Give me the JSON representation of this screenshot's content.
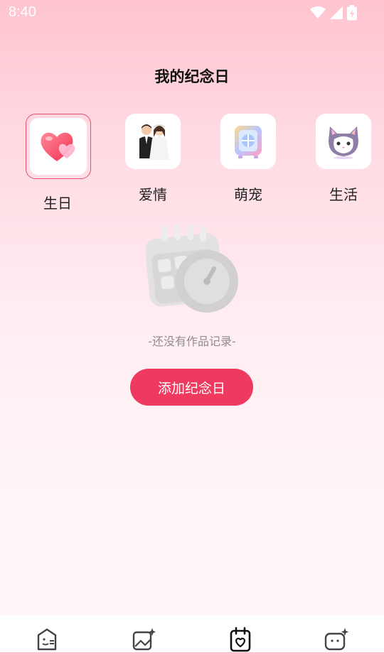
{
  "status": {
    "time": "8:40"
  },
  "page": {
    "title": "我的纪念日"
  },
  "categories": [
    {
      "label": "生日",
      "icon": "heart-icon",
      "selected": true
    },
    {
      "label": "爱情",
      "icon": "wedding-couple-icon",
      "selected": false
    },
    {
      "label": "萌宠",
      "icon": "pet-carrier-icon",
      "selected": false
    },
    {
      "label": "生活",
      "icon": "cat-icon",
      "selected": false
    }
  ],
  "empty_state": {
    "text": "-还没有作品记录-",
    "illustration": "calendar-clock-icon"
  },
  "actions": {
    "add_label": "添加纪念日"
  },
  "colors": {
    "accent": "#ee3a5e",
    "selected_border": "#e8506f"
  },
  "bottom_nav": [
    {
      "icon": "face-card-icon",
      "active": false
    },
    {
      "icon": "image-sparkle-icon",
      "active": false
    },
    {
      "icon": "calendar-heart-icon",
      "active": true
    },
    {
      "icon": "chat-sparkle-icon",
      "active": false
    }
  ]
}
